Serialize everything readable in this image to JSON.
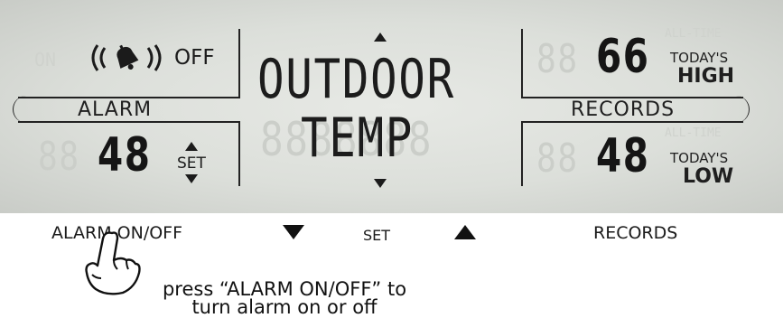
{
  "alarm": {
    "on_ghost": "ON",
    "off_label": "OFF",
    "section_label": "ALARM",
    "value": "48",
    "ghost_digits": "88",
    "set_label": "SET"
  },
  "center": {
    "line1": "OUTDOOR",
    "line2": "TEMP",
    "ghost_line": "8888888"
  },
  "records": {
    "section_label": "RECORDS",
    "high_value": "66",
    "high_ghost": "88",
    "today_label_1": "TODAY'S",
    "high_label": "HIGH",
    "low_value": "48",
    "low_ghost": "88",
    "today_label_2": "TODAY'S",
    "low_label": "LOW",
    "alltime_ghost_1": "ALL-TIME",
    "alltime_ghost_2": "ALL-TIME"
  },
  "buttons": {
    "alarm_on_off": "ALARM ON/OFF",
    "down_icon": "down-triangle",
    "set": "SET",
    "up_icon": "up-triangle",
    "records": "RECORDS"
  },
  "instruction": {
    "line1": "press “ALARM ON/OFF” to",
    "line2": "turn alarm on or off"
  }
}
